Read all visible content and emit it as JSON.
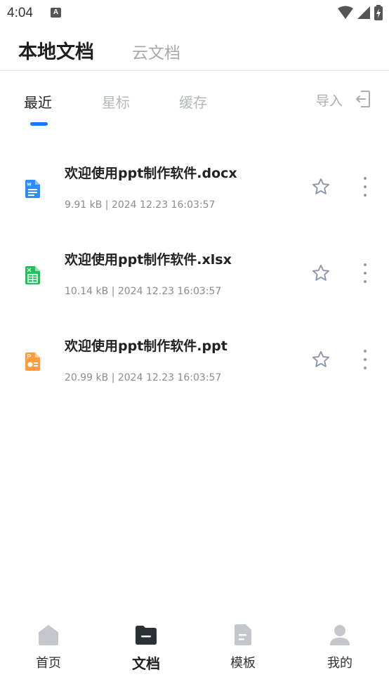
{
  "status_bar": {
    "time": "4:04",
    "notification_letter": "A"
  },
  "top_tabs": [
    {
      "label": "本地文档",
      "active": true
    },
    {
      "label": "云文档",
      "active": false
    }
  ],
  "sub_tabs": [
    {
      "label": "最近",
      "active": true
    },
    {
      "label": "星标",
      "active": false
    },
    {
      "label": "缓存",
      "active": false
    }
  ],
  "import_label": "导入",
  "files": [
    {
      "name": "欢迎使用ppt制作软件.docx",
      "meta": "9.91 kB | 2024 12.23 16:03:57",
      "type": "word",
      "icon": "word-file-icon",
      "color": "#2f8cff"
    },
    {
      "name": "欢迎使用ppt制作软件.xlsx",
      "meta": "10.14 kB | 2024 12.23 16:03:57",
      "type": "excel",
      "icon": "excel-file-icon",
      "color": "#22c05b"
    },
    {
      "name": "欢迎使用ppt制作软件.ppt",
      "meta": "20.99 kB | 2024 12.23 16:03:57",
      "type": "ppt",
      "icon": "ppt-file-icon",
      "color": "#ff9c3d"
    }
  ],
  "bottom_nav": [
    {
      "label": "首页",
      "icon": "home-icon",
      "active": false
    },
    {
      "label": "文档",
      "icon": "folder-icon",
      "active": true
    },
    {
      "label": "模板",
      "icon": "template-icon",
      "active": false
    },
    {
      "label": "我的",
      "icon": "profile-icon",
      "active": false
    }
  ],
  "colors": {
    "accent": "#1677ff",
    "inactive": "#b3b6bd"
  }
}
